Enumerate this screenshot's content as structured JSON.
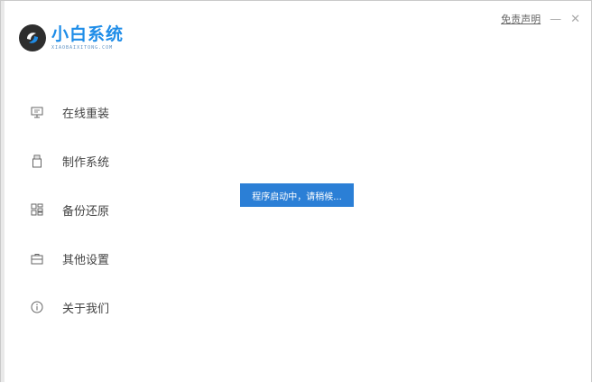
{
  "app": {
    "title": "小白系统",
    "subtitle": "XIAOBAIXITONG.COM"
  },
  "titlebar": {
    "disclaimer_label": "免责声明",
    "minimize_glyph": "—",
    "close_glyph": "✕"
  },
  "nav": {
    "items": [
      {
        "label": "在线重装",
        "icon": "monitor-icon"
      },
      {
        "label": "制作系统",
        "icon": "usb-icon"
      },
      {
        "label": "备份还原",
        "icon": "backup-icon"
      },
      {
        "label": "其他设置",
        "icon": "briefcase-icon"
      },
      {
        "label": "关于我们",
        "icon": "info-icon"
      }
    ]
  },
  "status": {
    "message": "程序启动中，请稍候..."
  },
  "colors": {
    "brand": "#1f8de8",
    "toast_bg": "#2b7fd6"
  }
}
